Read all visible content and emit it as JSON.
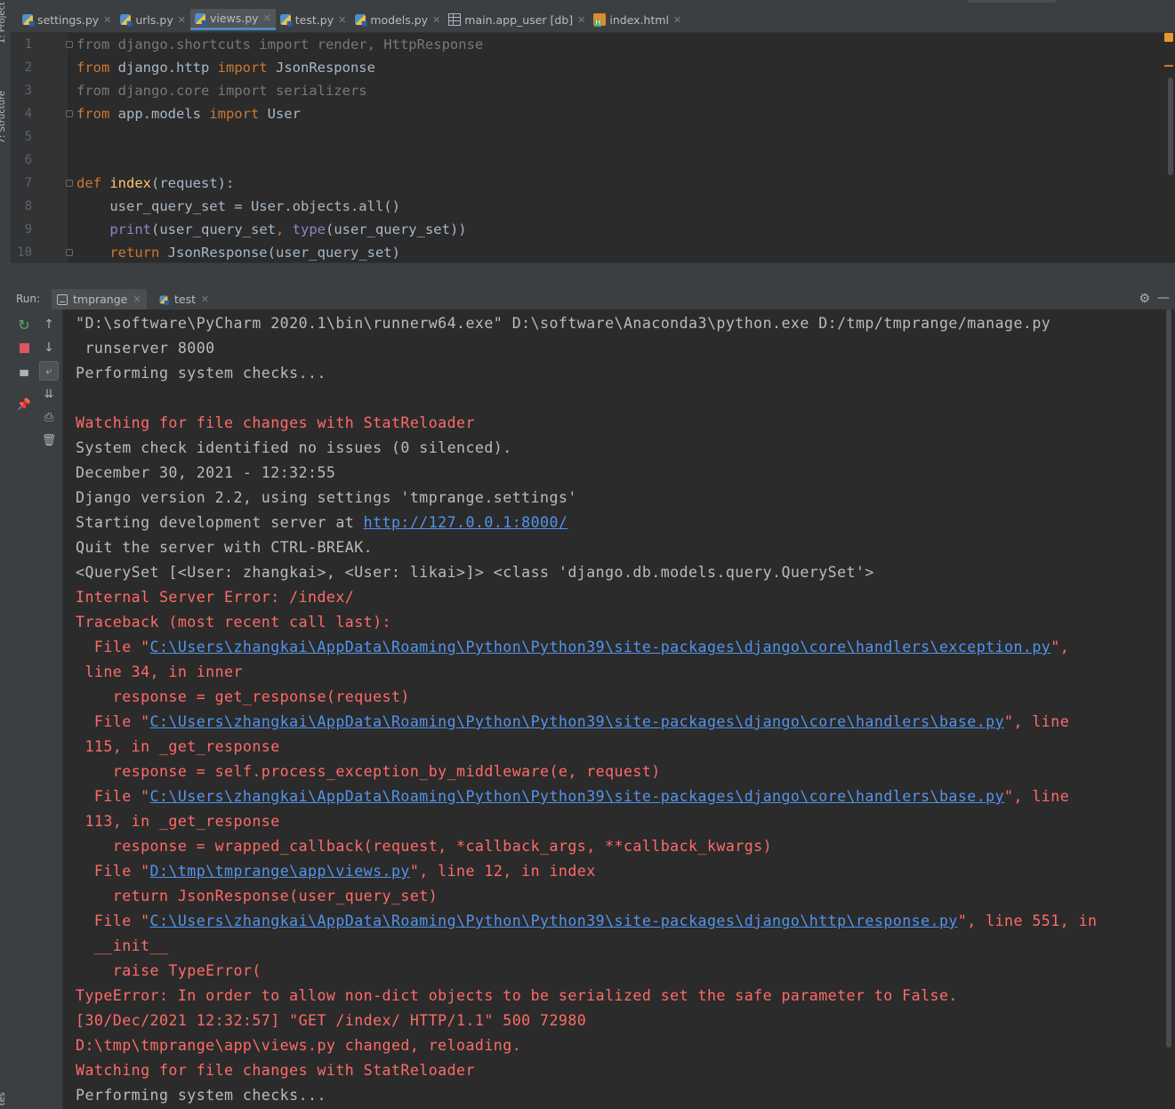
{
  "side_tools": {
    "project_label": "1: Project",
    "structure_label": "7: Structure",
    "bottom_label": "tes"
  },
  "tabs": [
    {
      "label": "settings.py",
      "icon": "python-file-icon",
      "active": false
    },
    {
      "label": "urls.py",
      "icon": "python-file-icon",
      "active": false
    },
    {
      "label": "views.py",
      "icon": "python-file-icon",
      "active": true
    },
    {
      "label": "test.py",
      "icon": "python-file-icon",
      "active": false
    },
    {
      "label": "models.py",
      "icon": "python-file-icon",
      "active": false
    },
    {
      "label": "main.app_user [db]",
      "icon": "db-table-icon",
      "active": false
    },
    {
      "label": "index.html",
      "icon": "html-file-icon",
      "active": false
    }
  ],
  "editor": {
    "line_numbers": [
      "1",
      "2",
      "3",
      "4",
      "5",
      "6",
      "7",
      "8",
      "9",
      "10"
    ],
    "lines": [
      [
        {
          "t": "from django.shortcuts import render, HttpResponse",
          "c": "un"
        }
      ],
      [
        {
          "t": "from",
          "c": "kw"
        },
        {
          "t": " django.http ",
          "c": "tx"
        },
        {
          "t": "import",
          "c": "kw"
        },
        {
          "t": " JsonResponse",
          "c": "tx"
        }
      ],
      [
        {
          "t": "from django.core import serializers",
          "c": "un"
        }
      ],
      [
        {
          "t": "from",
          "c": "kw"
        },
        {
          "t": " app.models ",
          "c": "tx"
        },
        {
          "t": "import",
          "c": "kw"
        },
        {
          "t": " User",
          "c": "tx"
        }
      ],
      [],
      [],
      [
        {
          "t": "def",
          "c": "kw"
        },
        {
          "t": " ",
          "c": "tx"
        },
        {
          "t": "index",
          "c": "df"
        },
        {
          "t": "(request):",
          "c": "tx"
        }
      ],
      [
        {
          "t": "    user_query_set = User.objects.all()",
          "c": "tx"
        }
      ],
      [
        {
          "t": "    ",
          "c": "tx"
        },
        {
          "t": "print",
          "c": "bi"
        },
        {
          "t": "(user_query_set",
          "c": "tx"
        },
        {
          "t": ", ",
          "c": "kw"
        },
        {
          "t": "type",
          "c": "bi"
        },
        {
          "t": "(user_query_set))",
          "c": "tx"
        }
      ],
      [
        {
          "t": "    ",
          "c": "tx"
        },
        {
          "t": "return",
          "c": "kw"
        },
        {
          "t": " JsonResponse(user_query_set)",
          "c": "tx"
        }
      ]
    ]
  },
  "run": {
    "label": "Run:",
    "tabs": [
      {
        "label": "tmprange",
        "active": true
      },
      {
        "label": "test",
        "active": false
      }
    ]
  },
  "console": [
    [
      {
        "t": "\"D:\\software\\PyCharm 2020.1\\bin\\runnerw64.exe\" D:\\software\\Anaconda3\\python.exe D:/tmp/tmprange/manage.py",
        "s": "norm"
      }
    ],
    [
      {
        "t": " runserver 8000",
        "s": "norm"
      }
    ],
    [
      {
        "t": "Performing system checks...",
        "s": "norm"
      }
    ],
    [],
    [
      {
        "t": "Watching for file changes with StatReloader",
        "s": "err"
      }
    ],
    [
      {
        "t": "System check identified no issues (0 silenced).",
        "s": "norm"
      }
    ],
    [
      {
        "t": "December 30, 2021 - 12:32:55",
        "s": "norm"
      }
    ],
    [
      {
        "t": "Django version 2.2, using settings 'tmprange.settings'",
        "s": "norm"
      }
    ],
    [
      {
        "t": "Starting development server at ",
        "s": "norm"
      },
      {
        "t": "http://127.0.0.1:8000/",
        "s": "link"
      }
    ],
    [
      {
        "t": "Quit the server with CTRL-BREAK.",
        "s": "norm"
      }
    ],
    [
      {
        "t": "<QuerySet [<User: zhangkai>, <User: likai>]> <class 'django.db.models.query.QuerySet'>",
        "s": "norm"
      }
    ],
    [
      {
        "t": "Internal Server Error: /index/",
        "s": "err"
      }
    ],
    [
      {
        "t": "Traceback (most recent call last):",
        "s": "err"
      }
    ],
    [
      {
        "t": "  File \"",
        "s": "err"
      },
      {
        "t": "C:\\Users\\zhangkai\\AppData\\Roaming\\Python\\Python39\\site-packages\\django\\core\\handlers\\exception.py",
        "s": "link"
      },
      {
        "t": "\",",
        "s": "err"
      }
    ],
    [
      {
        "t": " line 34, in inner",
        "s": "err"
      }
    ],
    [
      {
        "t": "    response = get_response(request)",
        "s": "err"
      }
    ],
    [
      {
        "t": "  File \"",
        "s": "err"
      },
      {
        "t": "C:\\Users\\zhangkai\\AppData\\Roaming\\Python\\Python39\\site-packages\\django\\core\\handlers\\base.py",
        "s": "link"
      },
      {
        "t": "\", line",
        "s": "err"
      }
    ],
    [
      {
        "t": " 115, in _get_response",
        "s": "err"
      }
    ],
    [
      {
        "t": "    response = self.process_exception_by_middleware(e, request)",
        "s": "err"
      }
    ],
    [
      {
        "t": "  File \"",
        "s": "err"
      },
      {
        "t": "C:\\Users\\zhangkai\\AppData\\Roaming\\Python\\Python39\\site-packages\\django\\core\\handlers\\base.py",
        "s": "link"
      },
      {
        "t": "\", line",
        "s": "err"
      }
    ],
    [
      {
        "t": " 113, in _get_response",
        "s": "err"
      }
    ],
    [
      {
        "t": "    response = wrapped_callback(request, *callback_args, **callback_kwargs)",
        "s": "err"
      }
    ],
    [
      {
        "t": "  File \"",
        "s": "err"
      },
      {
        "t": "D:\\tmp\\tmprange\\app\\views.py",
        "s": "link"
      },
      {
        "t": "\", line 12, in index",
        "s": "err"
      }
    ],
    [
      {
        "t": "    return JsonResponse(user_query_set)",
        "s": "err"
      }
    ],
    [
      {
        "t": "  File \"",
        "s": "err"
      },
      {
        "t": "C:\\Users\\zhangkai\\AppData\\Roaming\\Python\\Python39\\site-packages\\django\\http\\response.py",
        "s": "link"
      },
      {
        "t": "\", line 551, in",
        "s": "err"
      }
    ],
    [
      {
        "t": "  __init__",
        "s": "err"
      }
    ],
    [
      {
        "t": "    raise TypeError(",
        "s": "err"
      }
    ],
    [
      {
        "t": "TypeError: In order to allow non-dict objects to be serialized set the safe parameter to False.",
        "s": "err"
      }
    ],
    [
      {
        "t": "[30/Dec/2021 12:32:57] \"GET /index/ HTTP/1.1\" 500 72980",
        "s": "err"
      }
    ],
    [
      {
        "t": "D:\\tmp\\tmprange\\app\\views.py changed, reloading.",
        "s": "err"
      }
    ],
    [
      {
        "t": "Watching for file changes with StatReloader",
        "s": "err"
      }
    ],
    [
      {
        "t": "Performing system checks...",
        "s": "norm"
      }
    ]
  ],
  "colors": {
    "background": "#2b2b2b",
    "panel": "#3c3f41",
    "keyword": "#cc7832",
    "function_name": "#ffc66d",
    "builtin": "#8888c6",
    "unused_import": "#787878",
    "console_error": "#ff6b68",
    "console_link": "#5394ec",
    "active_tab_underline": "#4a88c7"
  }
}
